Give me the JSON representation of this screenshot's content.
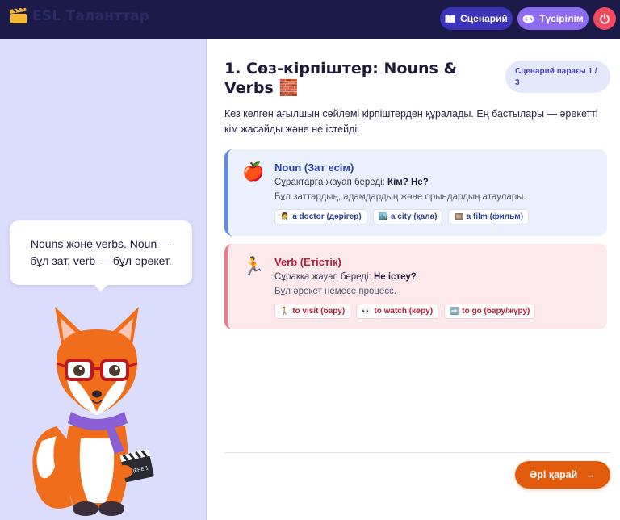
{
  "app": {
    "name": "ESL Таланттар"
  },
  "header": {
    "script_label": "Сценарий",
    "explain_label": "Түсірілім"
  },
  "sidebar": {
    "bubble_text": "Nouns және verbs. Noun — бұл зат, verb — бұл әрекет.",
    "clapper_text": "СЦЕНЕ 1"
  },
  "lesson": {
    "title": "1. Сөз-кірпіштер: Nouns & Verbs 🧱",
    "page_badge": "Сценарий парағы 1 / 3",
    "intro": "Кез келген ағылшын сөйлемі кірпіштерден құралады. Ең бастылары — әрекетті кім жасайды және не істейді.",
    "noun": {
      "icon": "🍎",
      "title": "Noun (Зат есім)",
      "question_prefix": "Сұрақтарға жауап береді: ",
      "question_bold": "Кім? Не?",
      "description": "Бұл заттардың, адамдардың және орындардың атаулары.",
      "chips": [
        {
          "icon": "👩‍⚕️",
          "label": "a doctor (дәрігер)"
        },
        {
          "icon": "🏙️",
          "label": "a city (қала)"
        },
        {
          "icon": "🎞️",
          "label": "a film (фильм)"
        }
      ]
    },
    "verb": {
      "icon": "🏃",
      "title": "Verb (Етістік)",
      "question_prefix": "Сұраққа жауап береді: ",
      "question_bold": "Не істеу?",
      "description": "Бұл әрекет немесе процесс.",
      "chips": [
        {
          "icon": "🚶",
          "label": "to visit (бару)"
        },
        {
          "icon": "👀",
          "label": "to watch (көру)"
        },
        {
          "icon": "➡️",
          "label": "to go (бару/жүру)"
        }
      ]
    },
    "next_label": "Әрі қарай",
    "next_arrow": "→"
  },
  "colors": {
    "topbar": "#1c1a48",
    "accent": "#3b34b8",
    "secondary": "#8e6cf0",
    "danger": "#ef4a5e",
    "cta": "#e25a0c"
  }
}
